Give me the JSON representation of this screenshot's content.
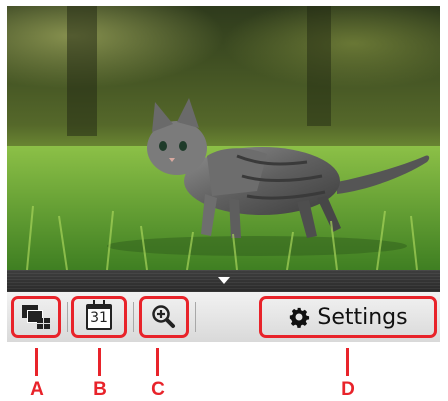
{
  "photo": {
    "subject": "kitten-on-grass"
  },
  "toolbar": {
    "calendar_day": "31",
    "settings_label": "Settings"
  },
  "callouts": {
    "a": "A",
    "b": "B",
    "c": "C",
    "d": "D"
  },
  "colors": {
    "callout": "#e8232a",
    "toolbar_bg": "#e6e6e6",
    "strip_bg": "#333333"
  }
}
